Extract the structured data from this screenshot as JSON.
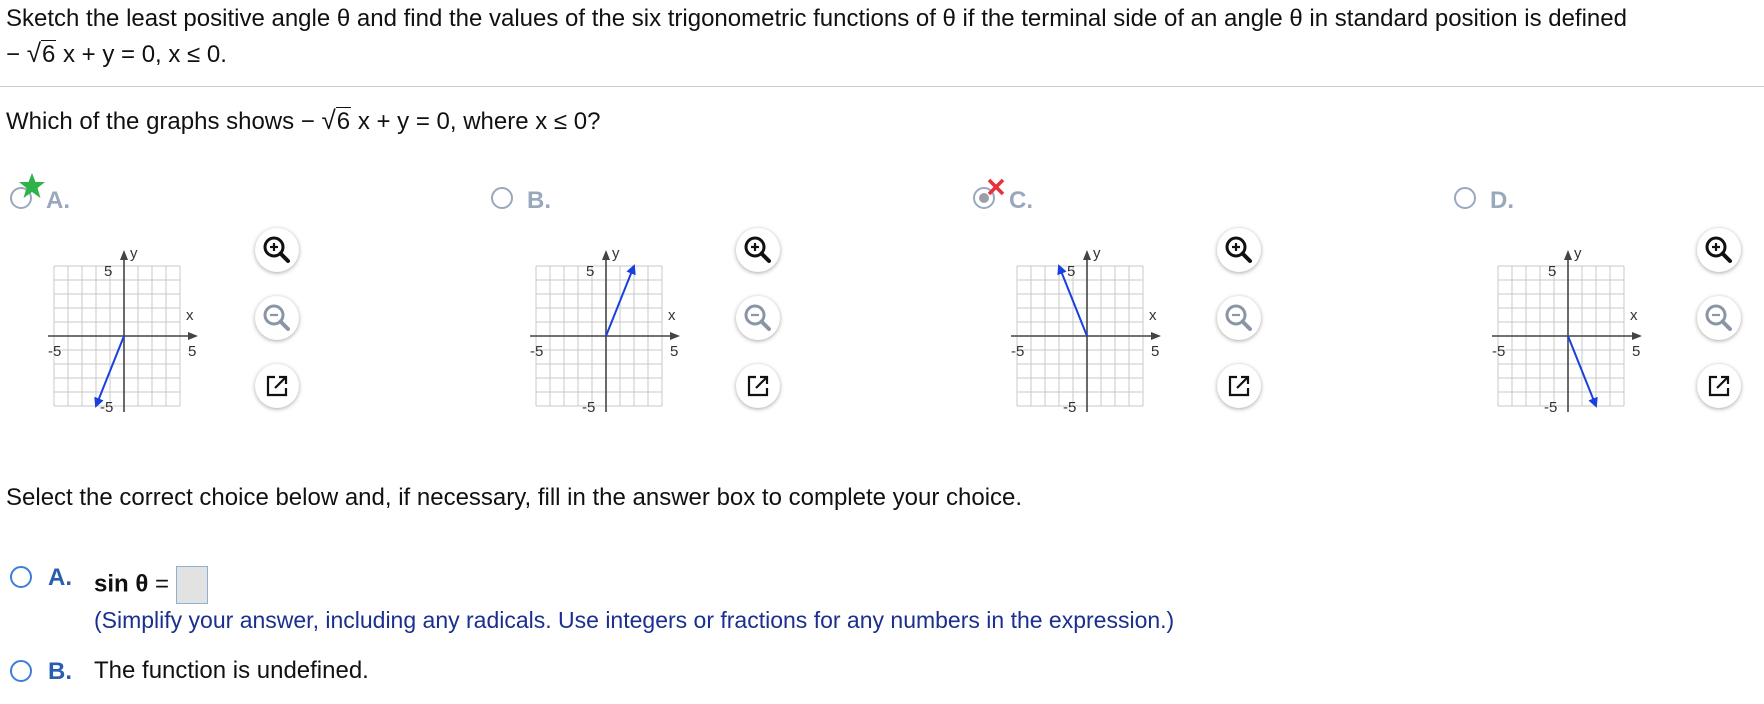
{
  "question": {
    "line1": "Sketch the least positive angle θ and find the values of the six trigonometric functions of θ if the terminal side of an angle θ in standard position is defined",
    "line2_pre": "−",
    "line2_rad": "6",
    "line2_post": "x + y = 0, x ≤ 0."
  },
  "subquestion": {
    "pre": "Which of the graphs shows  −",
    "rad": "6",
    "post": "x + y = 0, where x ≤ 0?"
  },
  "graph_options": [
    {
      "label": "A.",
      "status": "correct",
      "mark": "green-star-icon"
    },
    {
      "label": "B.",
      "status": "unselected"
    },
    {
      "label": "C.",
      "status": "incorrect-selected",
      "mark": "red-x-icon"
    },
    {
      "label": "D.",
      "status": "unselected"
    }
  ],
  "graph_axis": {
    "x_label": "x",
    "y_label": "y",
    "tick_pos": "5",
    "tick_neg": "-5",
    "xlim": [
      -5,
      5
    ],
    "ylim": [
      -5,
      5
    ]
  },
  "graph_rays": [
    {
      "from": [
        0,
        0
      ],
      "to": [
        -2,
        -5
      ]
    },
    {
      "from": [
        0,
        0
      ],
      "to": [
        2,
        5
      ]
    },
    {
      "from": [
        0,
        0
      ],
      "to": [
        -2,
        5
      ]
    },
    {
      "from": [
        0,
        0
      ],
      "to": [
        2,
        -5
      ]
    }
  ],
  "instruction": "Select the correct choice below and, if necessary, fill in the answer box to complete your choice.",
  "choices": {
    "a_label": "A.",
    "a_func": "sin θ",
    "a_eq": "=",
    "a_hint": "(Simplify your answer, including any radicals. Use integers or fractions for any numbers in the expression.)",
    "b_label": "B.",
    "b_text": "The function is undefined."
  },
  "colors": {
    "ray": "#1a3fe0",
    "grid": "#c8c8c8",
    "axis": "#444444",
    "radio": "#3d7ed8",
    "hint": "#1a2f8f",
    "star": "#2db34a",
    "x_mark": "#e8303a"
  }
}
